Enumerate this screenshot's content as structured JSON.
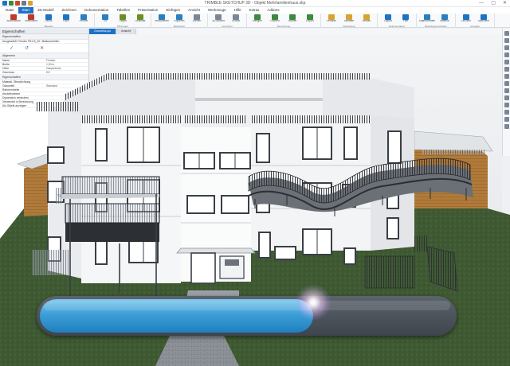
{
  "window": {
    "title": "TRIMBLE SKETCHUP 3D · Objekt Mehrfamilienhaus.skp",
    "controls": [
      "—",
      "▢",
      "✕"
    ]
  },
  "quick_access": {
    "colors": [
      "#1d72c6",
      "#3d8a3d",
      "#c94a2b",
      "#6c7a89",
      "#d8a32f"
    ]
  },
  "ribbon": {
    "tabs": [
      "Datei",
      "Start",
      "3D-Modell",
      "Zeichnen",
      "Dokumentation",
      "Tabellen",
      "Präsentation",
      "Einfügen",
      "Ansicht",
      "Werkzeuge",
      "Hilfe",
      "Extras",
      "Addons"
    ],
    "active_tab_index": 1,
    "groups": [
      {
        "name": "Bauteile",
        "buttons": [
          "Außenwand",
          "Innenwand",
          "Decke",
          "Dach",
          "Fenster"
        ],
        "colors": [
          "#c0392b",
          "#c0392b",
          "#1d72c6",
          "#1d72c6",
          "#2a7fbf"
        ]
      },
      {
        "name": "Öffnungen",
        "buttons": [
          "Tür",
          "Treppe",
          "Geländer"
        ],
        "colors": [
          "#2a7fbf",
          "#6b8e23",
          "#6b8e23"
        ]
      },
      {
        "name": "Bearbeiten",
        "buttons": [
          "Verschieben",
          "Kopieren",
          "Drehen"
        ],
        "colors": [
          "#2a7fbf",
          "#2a7fbf",
          "#7a8796"
        ]
      },
      {
        "name": "Ansichten",
        "buttons": [
          "3D-Ansicht",
          "Schnitt"
        ],
        "colors": [
          "#7a8796",
          "#7a8796"
        ]
      },
      {
        "name": "Berechnung",
        "buttons": [
          "Mengen",
          "Flächen",
          "Räume",
          "Export"
        ],
        "colors": [
          "#3d8a3d",
          "#3d8a3d",
          "#3d8a3d",
          "#3d8a3d"
        ]
      },
      {
        "name": "Darstellung",
        "buttons": [
          "Texturen",
          "Schatten",
          "Render"
        ],
        "colors": [
          "#d8a32f",
          "#d8a32f",
          "#d8a32f"
        ]
      },
      {
        "name": "Dokumentation",
        "buttons": [
          "Layout",
          "Plan"
        ],
        "colors": [
          "#1d72c6",
          "#1d72c6"
        ]
      },
      {
        "name": "Bauteileigenschaften",
        "buttons": [
          "Eigenschaften",
          "Material"
        ],
        "colors": [
          "#2a7fbf",
          "#2a7fbf"
        ]
      },
      {
        "name": "Ausgabe",
        "buttons": [
          "Drucken",
          "Speichern"
        ],
        "colors": [
          "#1d72c6",
          "#1d72c6"
        ]
      }
    ]
  },
  "properties_panel": {
    "title": "Eigenschaften",
    "subtitle": "Eigenschaften",
    "selection": "Ausgewählt: Fenster FN1 B_00 / Balkonstreifen",
    "actions": [
      "✓",
      "↺",
      "✕"
    ],
    "sections": [
      {
        "name": "Allgemein",
        "rows": [
          [
            "Name",
            "Fenster"
          ],
          [
            "Breite",
            "1,50 m"
          ],
          [
            "Höhe",
            "Hauptebene"
          ],
          [
            "Geschoss",
            "EG"
          ]
        ]
      },
      {
        "name": "Eigenschaften",
        "rows": [
          [
            "Material / Beschichtung",
            ""
          ],
          [
            "Glasanteil",
            "Standard"
          ],
          [
            "Rahmenbreite",
            ""
          ],
          [
            "Ansichtsebene",
            ""
          ],
          [
            "Dynamisch verändern",
            ""
          ],
          [
            "Verwendet in Berechnung",
            ""
          ],
          [
            "Als Objekt anzeigen",
            ""
          ]
        ]
      }
    ]
  },
  "document_tabs": [
    "Grundriss.ipc",
    "Ansicht"
  ],
  "active_document_tab": 0,
  "progress": {
    "value": 0.66
  }
}
